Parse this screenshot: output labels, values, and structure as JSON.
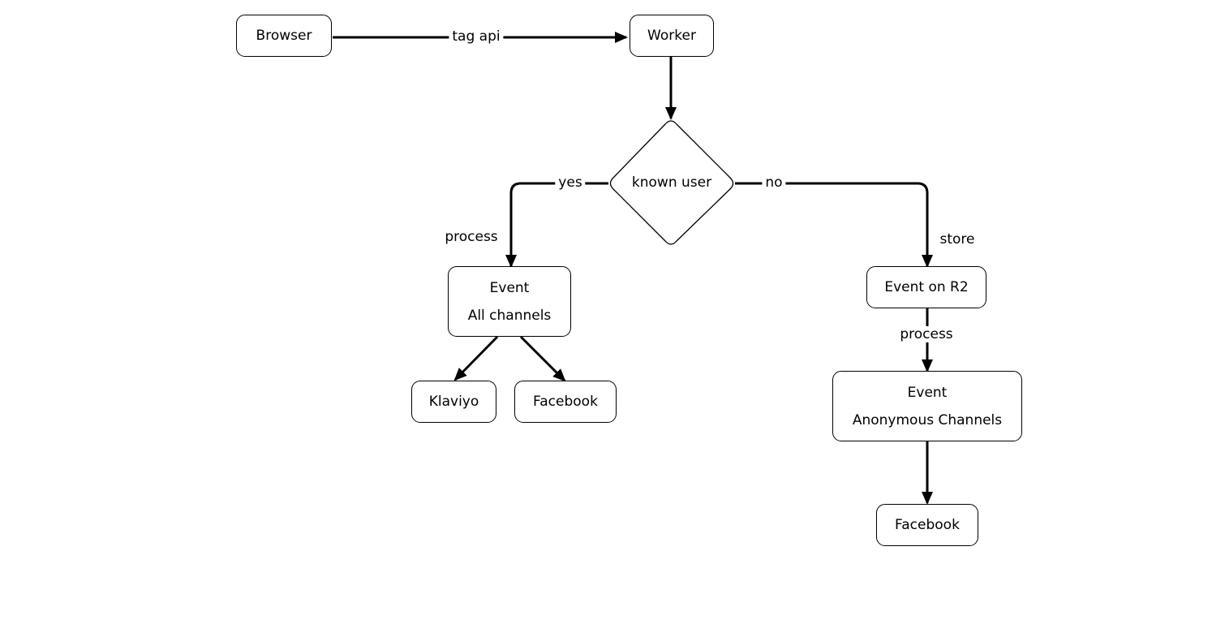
{
  "nodes": {
    "browser": "Browser",
    "worker": "Worker",
    "decision": "known user",
    "event_all": [
      "Event",
      "All channels"
    ],
    "klaviyo": "Klaviyo",
    "facebook_known": "Facebook",
    "event_r2": "Event on R2",
    "event_anon": [
      "Event",
      "Anonymous Channels"
    ],
    "facebook_anon": "Facebook"
  },
  "edges": {
    "browser_worker": "tag api",
    "yes": "yes",
    "no": "no",
    "process_known": "process",
    "store": "store",
    "process_anon": "process"
  }
}
